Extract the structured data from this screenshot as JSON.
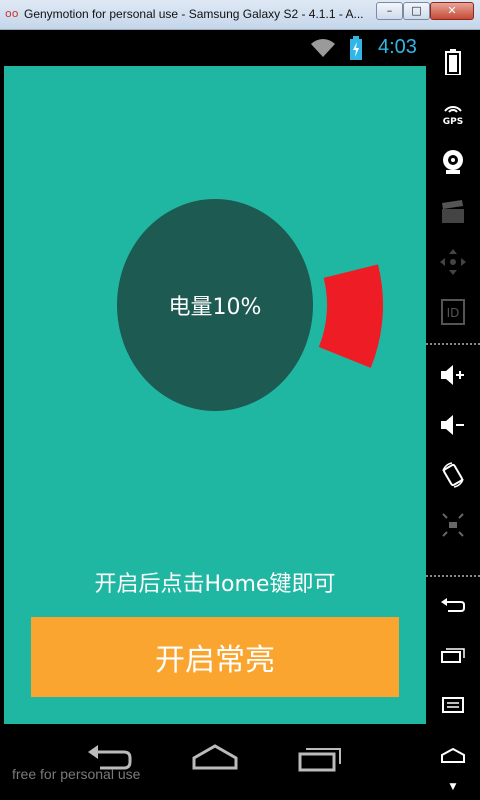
{
  "window": {
    "title": "Genymotion for personal use - Samsung Galaxy S2 - 4.1.1 - A...",
    "logo": "oo",
    "minimize_label": "–",
    "maximize_label": "□",
    "close_label": "✕"
  },
  "status_bar": {
    "time": "4:03",
    "icons": [
      "wifi-icon",
      "battery-charging-icon"
    ]
  },
  "app": {
    "battery_label": "电量10%",
    "battery_level_percent": 10,
    "hint": "开启后点击Home键即可",
    "enable_button": "开启常亮",
    "colors": {
      "background": "#20b7a2",
      "circle": "#1c5a52",
      "arc": "#ee1c24",
      "button": "#f9a52f"
    }
  },
  "nav_bar": {
    "buttons": [
      "back-icon",
      "home-icon",
      "recent-apps-icon"
    ]
  },
  "watermark": "free for personal use",
  "sidebar": {
    "gps_label": "GPS",
    "id_label": "ID",
    "icons": [
      "battery-icon",
      "gps-icon",
      "camera-icon",
      "clapperboard-icon",
      "dpad-icon",
      "id-icon",
      "volume-up-icon",
      "volume-down-icon",
      "rotate-icon",
      "scale-icon",
      "back-icon",
      "recent-apps-icon",
      "menu-icon",
      "home-icon"
    ]
  }
}
